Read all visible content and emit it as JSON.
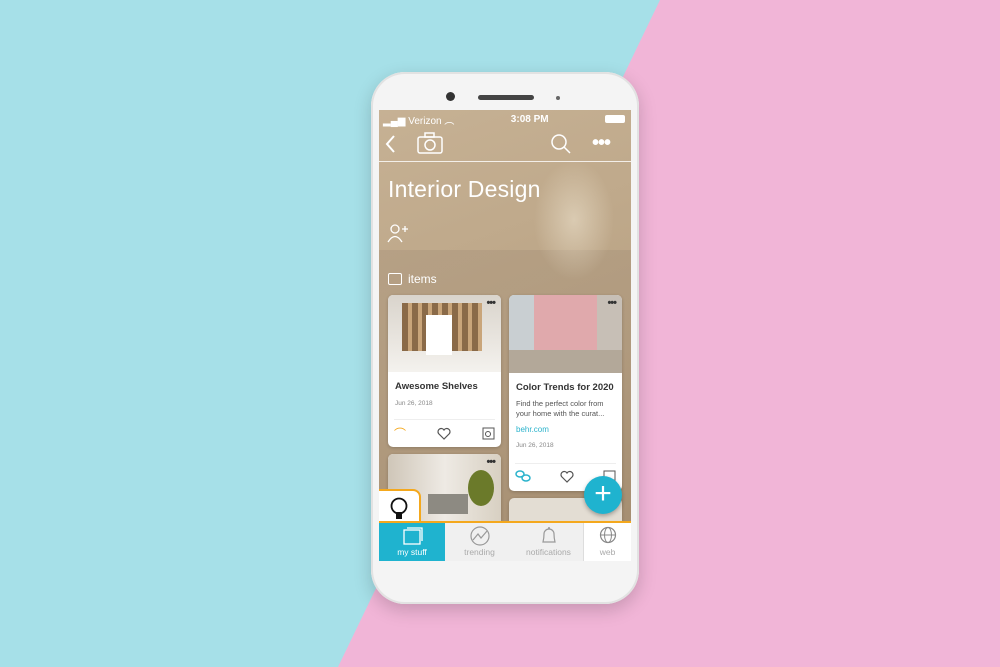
{
  "status": {
    "carrier": "Verizon",
    "time": "3:08 PM"
  },
  "header": {
    "title": "Interior Design",
    "items_label": "items"
  },
  "cards": [
    {
      "title": "Awesome Shelves",
      "date": "Jun 26, 2018"
    },
    {
      "title": "Color Trends for 2020",
      "description_1": "Find the perfect color from",
      "description_2": "your home with the curat...",
      "link": "behr.com",
      "date": "Jun 26, 2018"
    }
  ],
  "tabs": [
    {
      "label": "my stuff"
    },
    {
      "label": "trending"
    },
    {
      "label": "notifications"
    },
    {
      "label": "web"
    }
  ],
  "colors": {
    "accent": "#1fb3cf",
    "highlight": "#f4a81d"
  }
}
